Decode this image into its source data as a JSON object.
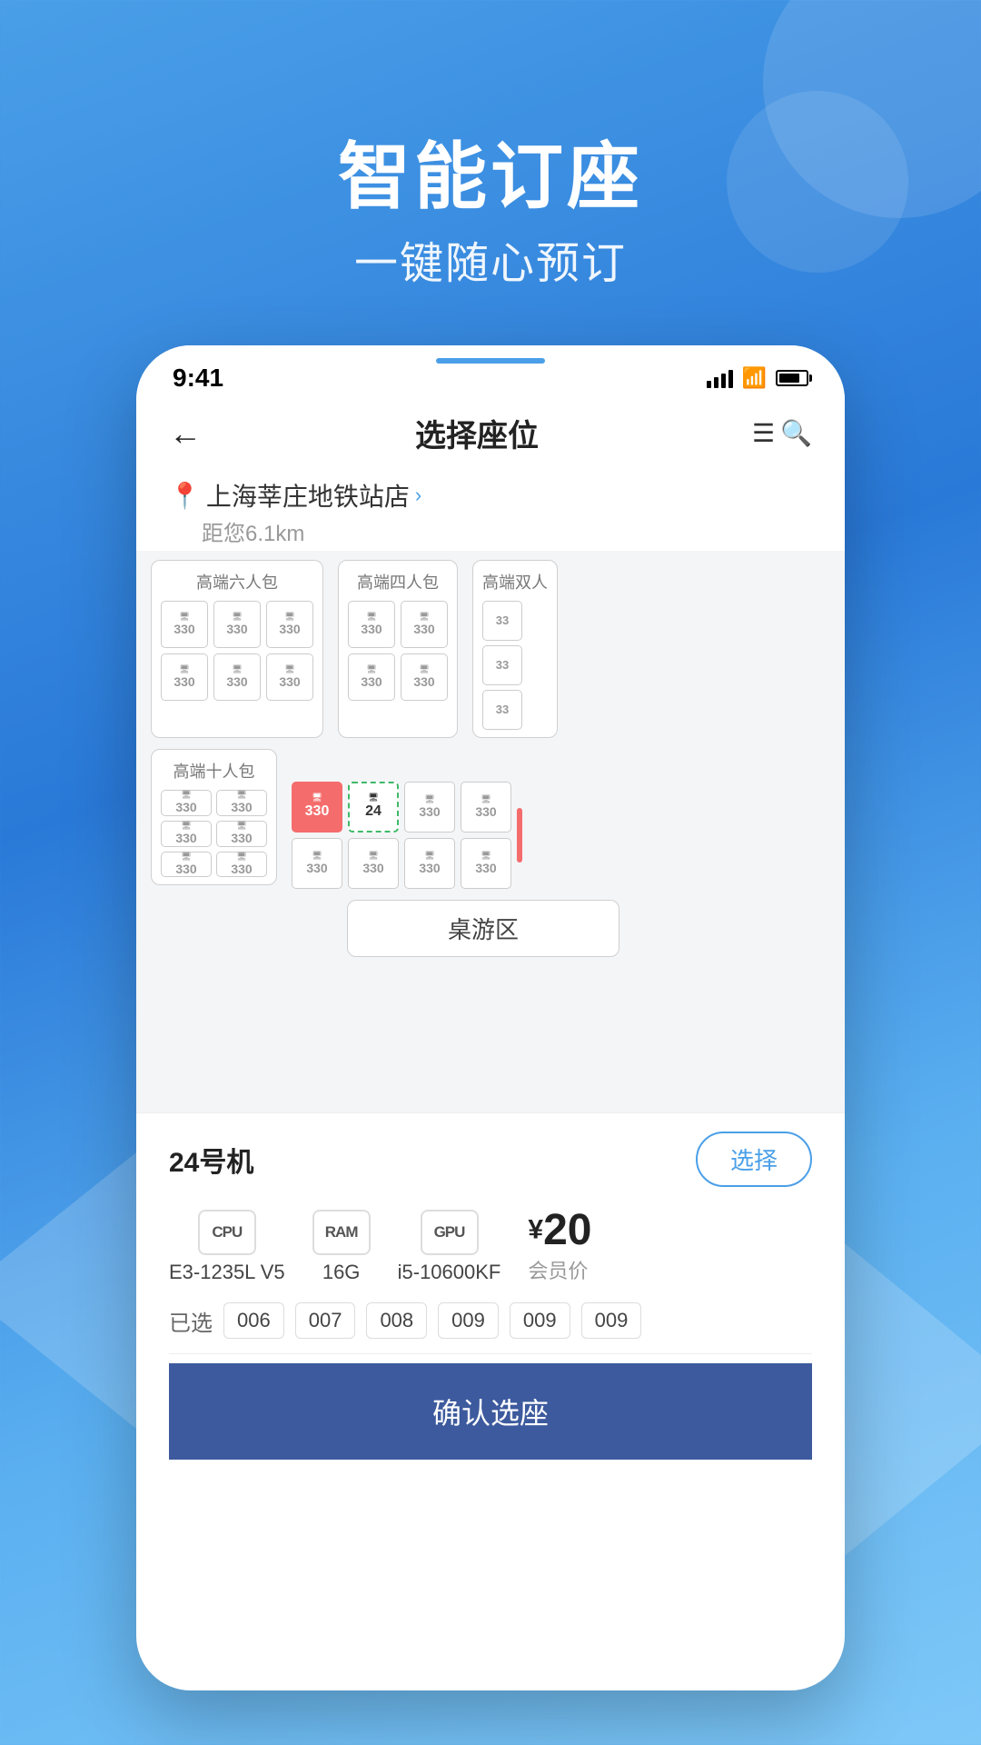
{
  "hero": {
    "title": "智能订座",
    "subtitle": "一键随心预订"
  },
  "statusBar": {
    "time": "9:41"
  },
  "navBar": {
    "title": "选择座位",
    "back_label": "←"
  },
  "location": {
    "name": "上海莘庄地铁站店",
    "distance": "距您6.1km"
  },
  "rooms": [
    {
      "label": "高端六人包",
      "price": "330",
      "cols": 3,
      "rows": 2
    },
    {
      "label": "高端四人包",
      "price": "330",
      "cols": 2,
      "rows": 2
    },
    {
      "label": "高端双人",
      "price": "33",
      "cols": 1,
      "rows": 3
    }
  ],
  "room10": {
    "label": "高端十人包"
  },
  "seats": {
    "selected_machine": "24号机",
    "select_button": "选择",
    "cpu_label": "E3-1235L V5",
    "ram_label": "16G",
    "gpu_label": "i5-10600KF",
    "price": "20",
    "price_symbol": "¥",
    "price_suffix": "会员价",
    "cpu_icon": "CPU",
    "ram_icon": "RAM",
    "gpu_icon": "GPU"
  },
  "selectedSeats": {
    "label": "已选",
    "tags": [
      "006",
      "007",
      "008",
      "009",
      "009",
      "009"
    ]
  },
  "confirmBtn": {
    "label": "确认选座"
  },
  "seatNumbers": {
    "normal": "330",
    "red": "330",
    "green": "24"
  },
  "tableZone": {
    "label": "桌游区"
  }
}
